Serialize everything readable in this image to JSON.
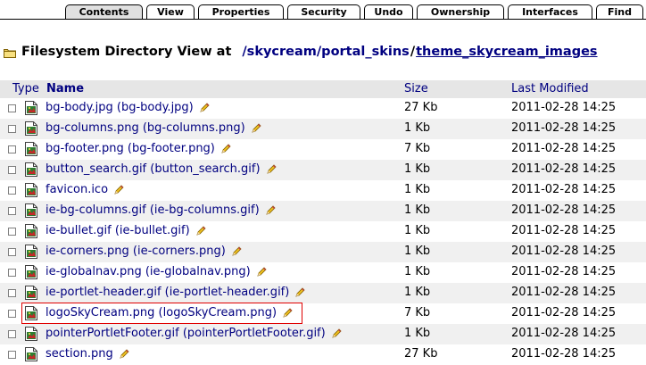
{
  "tabs": [
    {
      "label": "Contents",
      "active": true
    },
    {
      "label": "View"
    },
    {
      "label": "Properties"
    },
    {
      "label": "Security"
    },
    {
      "label": "Undo"
    },
    {
      "label": "Ownership"
    },
    {
      "label": "Interfaces"
    },
    {
      "label": "Find"
    }
  ],
  "heading": {
    "prefix": "Filesystem Directory View at",
    "crumbs": [
      "/skycream",
      "/portal_skins",
      "/",
      "theme_skycream_images"
    ]
  },
  "table": {
    "columns": {
      "type": "Type",
      "name": "Name",
      "size": "Size",
      "modified": "Last Modified"
    },
    "rows": [
      {
        "name": "bg-body.jpg (bg-body.jpg)",
        "size": "27 Kb",
        "modified": "2011-02-28 14:25"
      },
      {
        "name": "bg-columns.png (bg-columns.png)",
        "size": "1 Kb",
        "modified": "2011-02-28 14:25"
      },
      {
        "name": "bg-footer.png (bg-footer.png)",
        "size": "7 Kb",
        "modified": "2011-02-28 14:25"
      },
      {
        "name": "button_search.gif (button_search.gif)",
        "size": "1 Kb",
        "modified": "2011-02-28 14:25"
      },
      {
        "name": "favicon.ico",
        "size": "1 Kb",
        "modified": "2011-02-28 14:25"
      },
      {
        "name": "ie-bg-columns.gif (ie-bg-columns.gif)",
        "size": "1 Kb",
        "modified": "2011-02-28 14:25"
      },
      {
        "name": "ie-bullet.gif (ie-bullet.gif)",
        "size": "1 Kb",
        "modified": "2011-02-28 14:25"
      },
      {
        "name": "ie-corners.png (ie-corners.png)",
        "size": "1 Kb",
        "modified": "2011-02-28 14:25"
      },
      {
        "name": "ie-globalnav.png (ie-globalnav.png)",
        "size": "1 Kb",
        "modified": "2011-02-28 14:25"
      },
      {
        "name": "ie-portlet-header.gif (ie-portlet-header.gif)",
        "size": "1 Kb",
        "modified": "2011-02-28 14:25"
      },
      {
        "name": "logoSkyCream.png (logoSkyCream.png)",
        "size": "7 Kb",
        "modified": "2011-02-28 14:25",
        "highlighted": true
      },
      {
        "name": "pointerPortletFooter.gif (pointerPortletFooter.gif)",
        "size": "1 Kb",
        "modified": "2011-02-28 14:25"
      },
      {
        "name": "section.png",
        "size": "27 Kb",
        "modified": "2011-02-28 14:25"
      }
    ]
  },
  "colors": {
    "link": "#000080",
    "highlight": "#e00000",
    "header_bg": "#e6e6e6",
    "row_alt": "#f0f0f0"
  }
}
